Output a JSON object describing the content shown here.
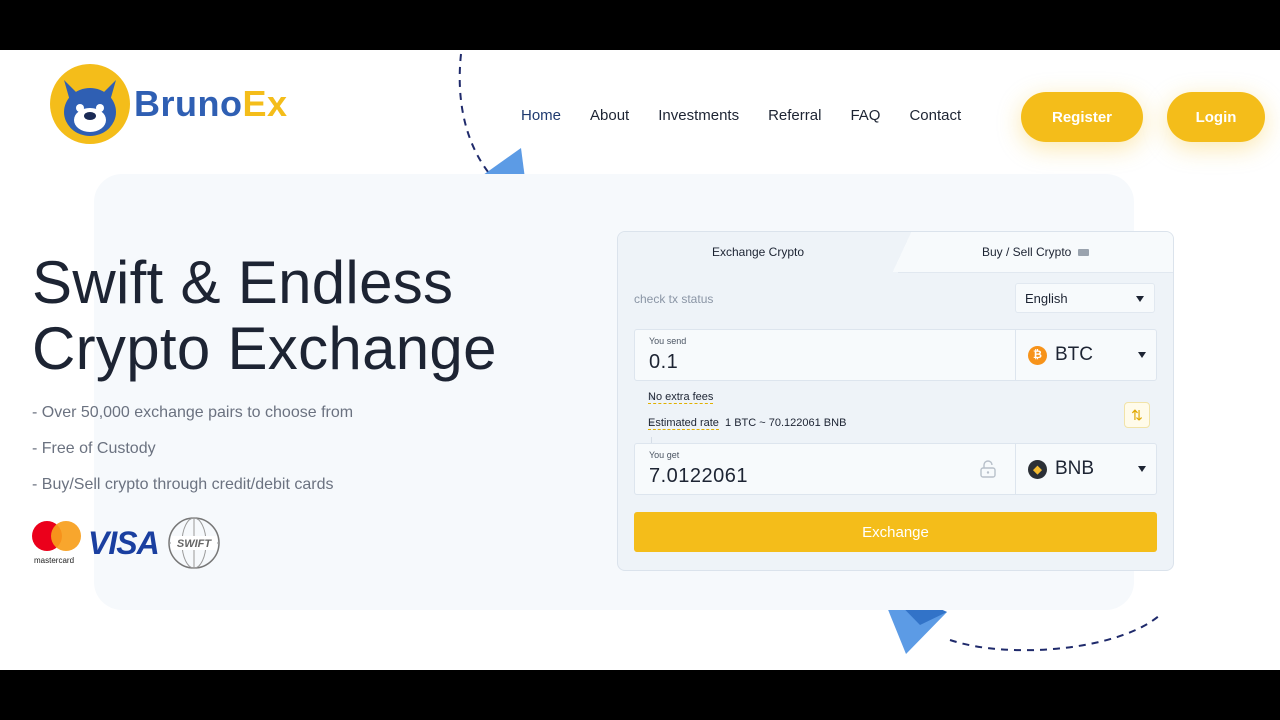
{
  "brand": {
    "name_part1": "Bruno",
    "name_part2": "Ex"
  },
  "nav": {
    "items": [
      "Home",
      "About",
      "Investments",
      "Referral",
      "FAQ",
      "Contact"
    ]
  },
  "auth": {
    "register_label": "Register",
    "login_label": "Login"
  },
  "hero": {
    "headline_line1": "Swift & Endless",
    "headline_line2": "Crypto Exchange",
    "features": [
      "- Over 50,000 exchange pairs to choose from",
      "- Free of Custody",
      "- Buy/Sell crypto through credit/debit cards"
    ],
    "payments": {
      "mastercard_label": "mastercard",
      "visa_label": "VISA",
      "swift_label": "SWIFT"
    }
  },
  "widget": {
    "tabs": [
      "Exchange Crypto",
      "Buy / Sell Crypto"
    ],
    "check_tx_label": "check tx status",
    "language": "English",
    "send": {
      "label": "You send",
      "value": "0.1",
      "currency": "BTC",
      "currency_symbol": "₿"
    },
    "info": {
      "no_fees": "No extra fees",
      "rate_label": "Estimated rate",
      "rate_value": "1 BTC ~ 70.122061 BNB"
    },
    "get": {
      "label": "You get",
      "value": "7.0122061",
      "currency": "BNB",
      "currency_symbol": "◆"
    },
    "exchange_label": "Exchange"
  },
  "colors": {
    "accent": "#f4bd1a",
    "brand_blue": "#2f5fb3",
    "text": "#1d2433"
  }
}
